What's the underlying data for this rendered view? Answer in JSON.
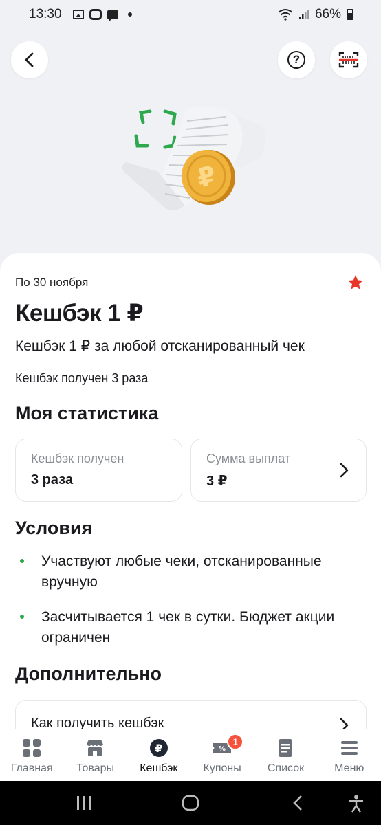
{
  "status_bar": {
    "time": "13:30",
    "battery": "66%"
  },
  "promo": {
    "period": "По 30 ноября",
    "title": "Кешбэк 1 ₽",
    "description": "Кешбэк 1 ₽ за любой отсканированный чек",
    "received_text": "Кешбэк получен 3 раза"
  },
  "stats": {
    "title": "Моя статистика",
    "cards": [
      {
        "label": "Кешбэк получен",
        "value": "3 раза"
      },
      {
        "label": "Сумма выплат",
        "value": "3 ₽"
      }
    ]
  },
  "conditions": {
    "title": "Условия",
    "items": [
      "Участвуют любые чеки, отсканированные вручную",
      "Засчитывается 1 чек в сутки. Бюджет акции ограничен"
    ]
  },
  "extra": {
    "title": "Дополнительно",
    "link_label": "Как получить кешбэк"
  },
  "bottom_nav": {
    "items": [
      {
        "label": "Главная",
        "icon": "grid-icon"
      },
      {
        "label": "Товары",
        "icon": "store-icon"
      },
      {
        "label": "Кешбэк",
        "icon": "ruble-coin-icon",
        "active": true
      },
      {
        "label": "Купоны",
        "icon": "coupon-icon",
        "badge": "1"
      },
      {
        "label": "Список",
        "icon": "list-icon"
      },
      {
        "label": "Меню",
        "icon": "menu-icon"
      }
    ]
  },
  "colors": {
    "accent_green": "#2ea84c",
    "badge_red": "#f4523b",
    "star_red": "#e8352a",
    "coin_gold": "#e9a82c"
  }
}
